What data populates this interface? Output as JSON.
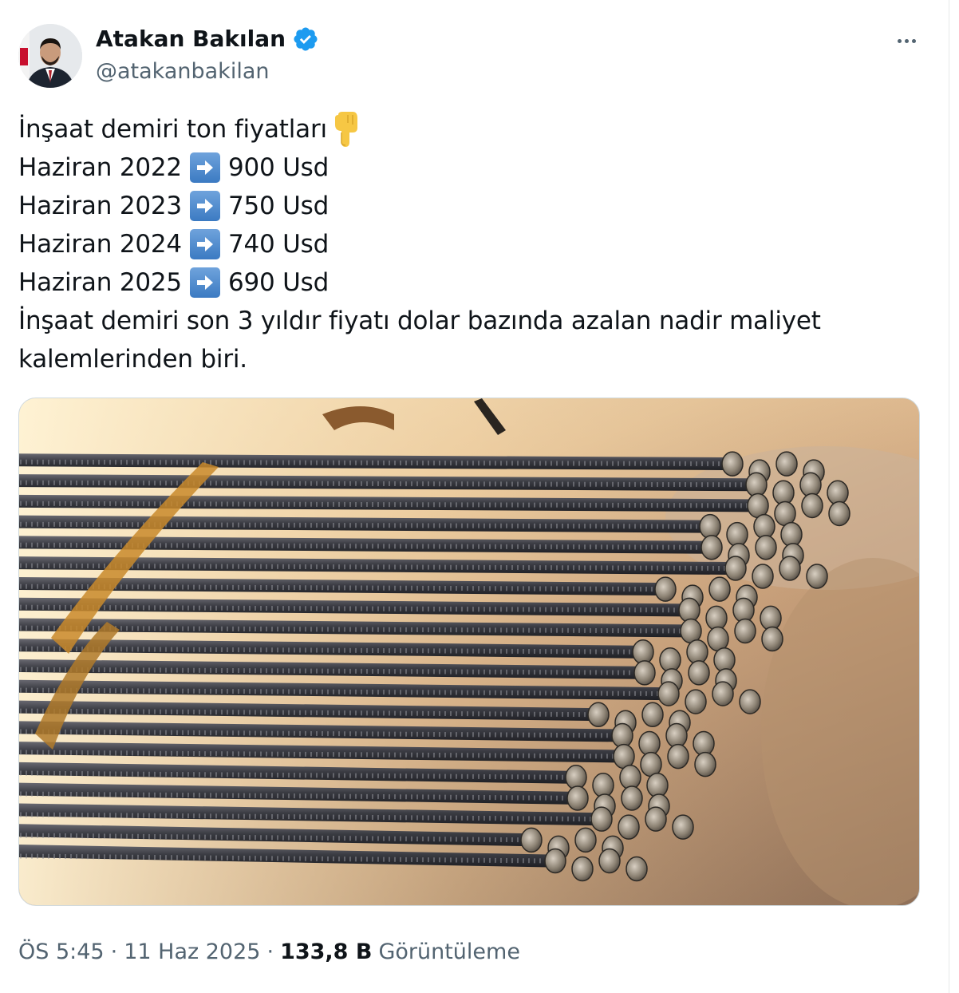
{
  "author": {
    "display_name": "Atakan Bakılan",
    "handle": "@atakanbakilan",
    "verified": true,
    "avatar_icon": "profile-photo"
  },
  "menu_icon": "more-dots-icon",
  "tweet": {
    "line1": "İnşaat demiri ton fiyatları",
    "line1_emoji": "backhand-index-pointing-down-emoji",
    "prices": [
      {
        "label": "Haziran 2022",
        "value": "900 Usd"
      },
      {
        "label": "Haziran 2023",
        "value": "750 Usd"
      },
      {
        "label": "Haziran 2024",
        "value": "740 Usd"
      },
      {
        "label": "Haziran 2025",
        "value": "690 Usd"
      }
    ],
    "arrow_emoji": "right-arrow-emoji",
    "closing": "İnşaat demiri son 3 yıldır fiyatı dolar bazında azalan nadir maliyet kalemlerinden biri."
  },
  "media": {
    "kind": "photo",
    "subject": "rebar-bundle"
  },
  "meta": {
    "time": "ÖS 5:45",
    "date": "11 Haz 2025",
    "views_count": "133,8 B",
    "views_label": "Görüntüleme"
  },
  "colors": {
    "text": "#0f1419",
    "secondary": "#536471",
    "verified_blue": "#1d9bf0",
    "border": "#cfd9de"
  }
}
